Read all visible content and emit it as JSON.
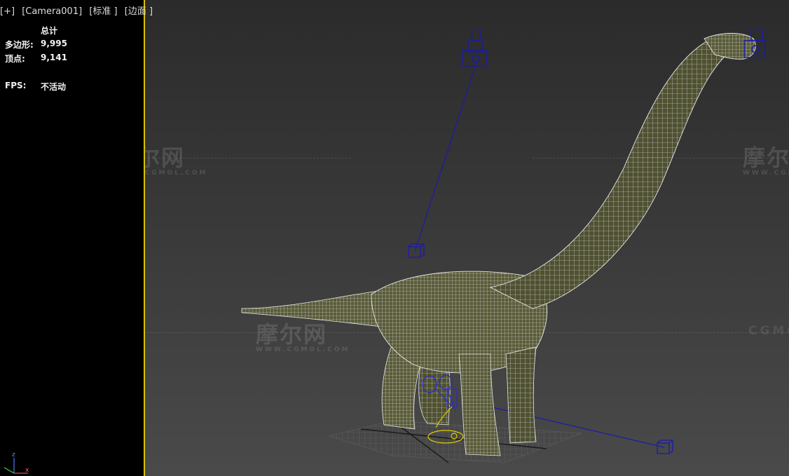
{
  "viewport": {
    "menu_plus": "[+]",
    "camera": "[Camera001]",
    "shading": "[标准 ]",
    "edges": "[边面 ]"
  },
  "stats": {
    "header": "总计",
    "polygons_label": "多边形:",
    "polygons_value": "9,995",
    "vertices_label": "顶点:",
    "vertices_value": "9,141",
    "fps_label": "FPS:",
    "fps_value": "不活动"
  },
  "watermark": {
    "cn": "摩尔网",
    "url": "WWW.CGMOL.COM",
    "brand": "CGMOL"
  },
  "axis": {
    "z": "z",
    "x": "x"
  },
  "colors": {
    "selection_border": "#d8c200",
    "wire": "#e8e8e8",
    "mesh_fill": "#4f5132",
    "helper": "#2020c0",
    "light": "#e0d000"
  }
}
